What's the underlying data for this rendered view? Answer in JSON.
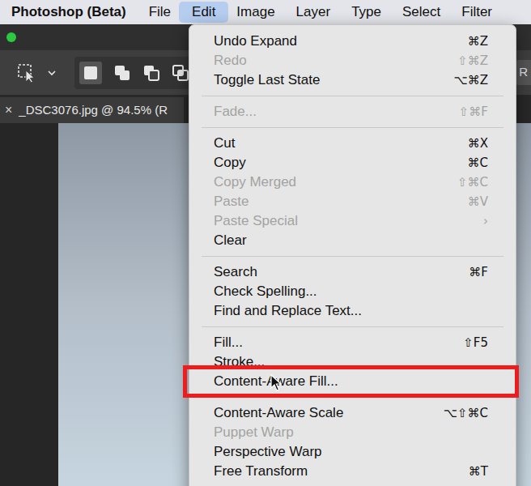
{
  "menubar": {
    "app": "Photoshop (Beta)",
    "menus": [
      {
        "label": "File",
        "selected": false
      },
      {
        "label": "Edit",
        "selected": true
      },
      {
        "label": "Image",
        "selected": false
      },
      {
        "label": "Layer",
        "selected": false
      },
      {
        "label": "Type",
        "selected": false
      },
      {
        "label": "Select",
        "selected": false
      },
      {
        "label": "Filter",
        "selected": false
      }
    ]
  },
  "options_bar": {
    "cut_text": "R"
  },
  "document_tab": {
    "close": "×",
    "title": "_DSC3076.jpg @ 94.5% (R"
  },
  "menu": {
    "items": [
      {
        "kind": "item",
        "label": "Undo Expand",
        "shortcut": "⌘Z",
        "disabled": false,
        "annotated": false
      },
      {
        "kind": "item",
        "label": "Redo",
        "shortcut": "⇧⌘Z",
        "disabled": true,
        "annotated": false
      },
      {
        "kind": "item",
        "label": "Toggle Last State",
        "shortcut": "⌥⌘Z",
        "disabled": false,
        "annotated": false
      },
      {
        "kind": "separator"
      },
      {
        "kind": "item",
        "label": "Fade...",
        "shortcut": "⇧⌘F",
        "disabled": true,
        "annotated": false
      },
      {
        "kind": "separator"
      },
      {
        "kind": "item",
        "label": "Cut",
        "shortcut": "⌘X",
        "disabled": false,
        "annotated": false
      },
      {
        "kind": "item",
        "label": "Copy",
        "shortcut": "⌘C",
        "disabled": false,
        "annotated": false
      },
      {
        "kind": "item",
        "label": "Copy Merged",
        "shortcut": "⇧⌘C",
        "disabled": true,
        "annotated": false
      },
      {
        "kind": "item",
        "label": "Paste",
        "shortcut": "⌘V",
        "disabled": true,
        "annotated": false
      },
      {
        "kind": "item",
        "label": "Paste Special",
        "shortcut": "›",
        "disabled": true,
        "annotated": false
      },
      {
        "kind": "item",
        "label": "Clear",
        "shortcut": "",
        "disabled": false,
        "annotated": false
      },
      {
        "kind": "separator"
      },
      {
        "kind": "item",
        "label": "Search",
        "shortcut": "⌘F",
        "disabled": false,
        "annotated": false
      },
      {
        "kind": "item",
        "label": "Check Spelling...",
        "shortcut": "",
        "disabled": false,
        "annotated": false
      },
      {
        "kind": "item",
        "label": "Find and Replace Text...",
        "shortcut": "",
        "disabled": false,
        "annotated": false
      },
      {
        "kind": "separator"
      },
      {
        "kind": "item",
        "label": "Fill...",
        "shortcut": "⇧F5",
        "disabled": false,
        "annotated": false
      },
      {
        "kind": "item",
        "label": "Stroke...",
        "shortcut": "",
        "disabled": false,
        "annotated": false
      },
      {
        "kind": "item",
        "label": "Content-Aware Fill...",
        "shortcut": "",
        "disabled": false,
        "annotated": true
      },
      {
        "kind": "separator"
      },
      {
        "kind": "item",
        "label": "Content-Aware Scale",
        "shortcut": "⌥⇧⌘C",
        "disabled": false,
        "annotated": false
      },
      {
        "kind": "item",
        "label": "Puppet Warp",
        "shortcut": "",
        "disabled": true,
        "annotated": false
      },
      {
        "kind": "item",
        "label": "Perspective Warp",
        "shortcut": "",
        "disabled": false,
        "annotated": false
      },
      {
        "kind": "item",
        "label": "Free Transform",
        "shortcut": "⌘T",
        "disabled": false,
        "annotated": false
      }
    ]
  }
}
